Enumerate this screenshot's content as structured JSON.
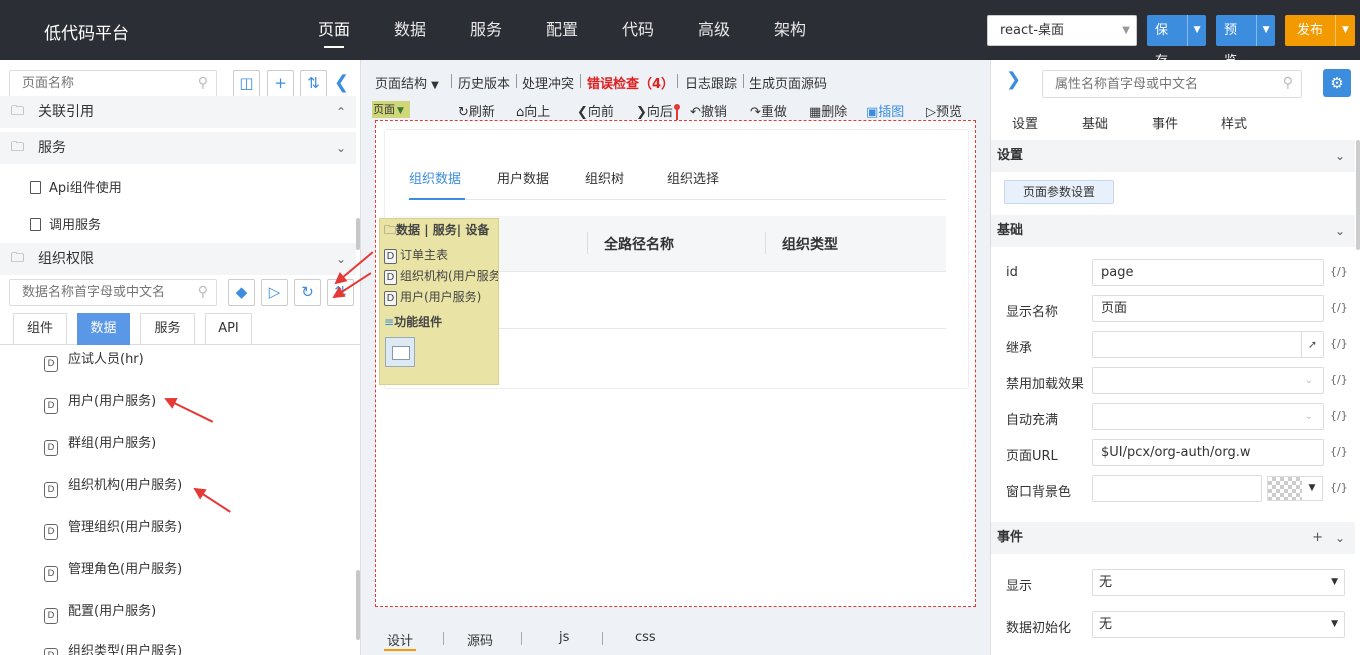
{
  "topbar": {
    "brand": "低代码平台",
    "nav": [
      "页面",
      "数据",
      "服务",
      "配置",
      "代码",
      "高级",
      "架构"
    ],
    "env_select": "react-桌面",
    "save_label": "保存",
    "preview_label": "预览",
    "publish_label": "发布"
  },
  "left": {
    "search_placeholder": "页面名称",
    "sections": {
      "refs": "关联引用",
      "services": "服务",
      "org_auth": "组织权限"
    },
    "service_items": [
      "Api组件使用",
      "调用服务"
    ],
    "ds_search_placeholder": "数据名称首字母或中文名",
    "tabs": [
      "组件",
      "数据",
      "服务",
      "API"
    ],
    "data_items": [
      "应试人员(hr)",
      "用户(用户服务)",
      "群组(用户服务)",
      "组织机构(用户服务)",
      "管理组织(用户服务)",
      "管理角色(用户服务)",
      "配置(用户服务)",
      "组织类型(用户服务)"
    ]
  },
  "center": {
    "toolbar": {
      "page_structure": "页面结构",
      "history": "历史版本",
      "conflict": "处理冲突",
      "error_check": "错误检查（4）",
      "log": "日志跟踪",
      "gen_source": "生成页面源码"
    },
    "toolbar2": {
      "page_tag": "页面",
      "refresh": "刷新",
      "up": "向上",
      "forward": "向前",
      "back": "向后",
      "undo": "撤销",
      "redo": "重做",
      "delete": "删除",
      "screenshot": "插图",
      "preview": "预览"
    },
    "tabs": [
      "组织数据",
      "用户数据",
      "组织树",
      "组织选择"
    ],
    "table_headers": [
      "全路径名称",
      "组织类型"
    ],
    "dnd": {
      "header": "数据 | 服务| 设备",
      "items": [
        "订单主表",
        "组织机构(用户服务)",
        "用户(用户服务)"
      ],
      "func_header": "功能组件"
    },
    "bottom_tabs": [
      "设计",
      "源码",
      "js",
      "css"
    ]
  },
  "right": {
    "search_placeholder": "属性名称首字母或中文名",
    "tabs": [
      "设置",
      "基础",
      "事件",
      "样式"
    ],
    "sec_settings": "设置",
    "page_param_btn": "页面参数设置",
    "sec_basic": "基础",
    "fields": [
      {
        "label": "id",
        "value": "page"
      },
      {
        "label": "显示名称",
        "value": "页面"
      },
      {
        "label": "继承",
        "value": ""
      },
      {
        "label": "禁用加载效果",
        "value": ""
      },
      {
        "label": "自动充满",
        "value": ""
      },
      {
        "label": "页面URL",
        "value": "$UI/pcx/org-auth/org.w"
      },
      {
        "label": "窗口背景色",
        "value": ""
      }
    ],
    "expr": "{/}",
    "sec_events": "事件",
    "events": [
      {
        "label": "显示",
        "value": "无"
      },
      {
        "label": "数据初始化",
        "value": "无"
      }
    ]
  },
  "colors": {
    "topbar_bg": "#2c2e35",
    "accent_blue": "#3c8dde",
    "publish_orange": "#f29a00",
    "error_red": "#e02020"
  }
}
